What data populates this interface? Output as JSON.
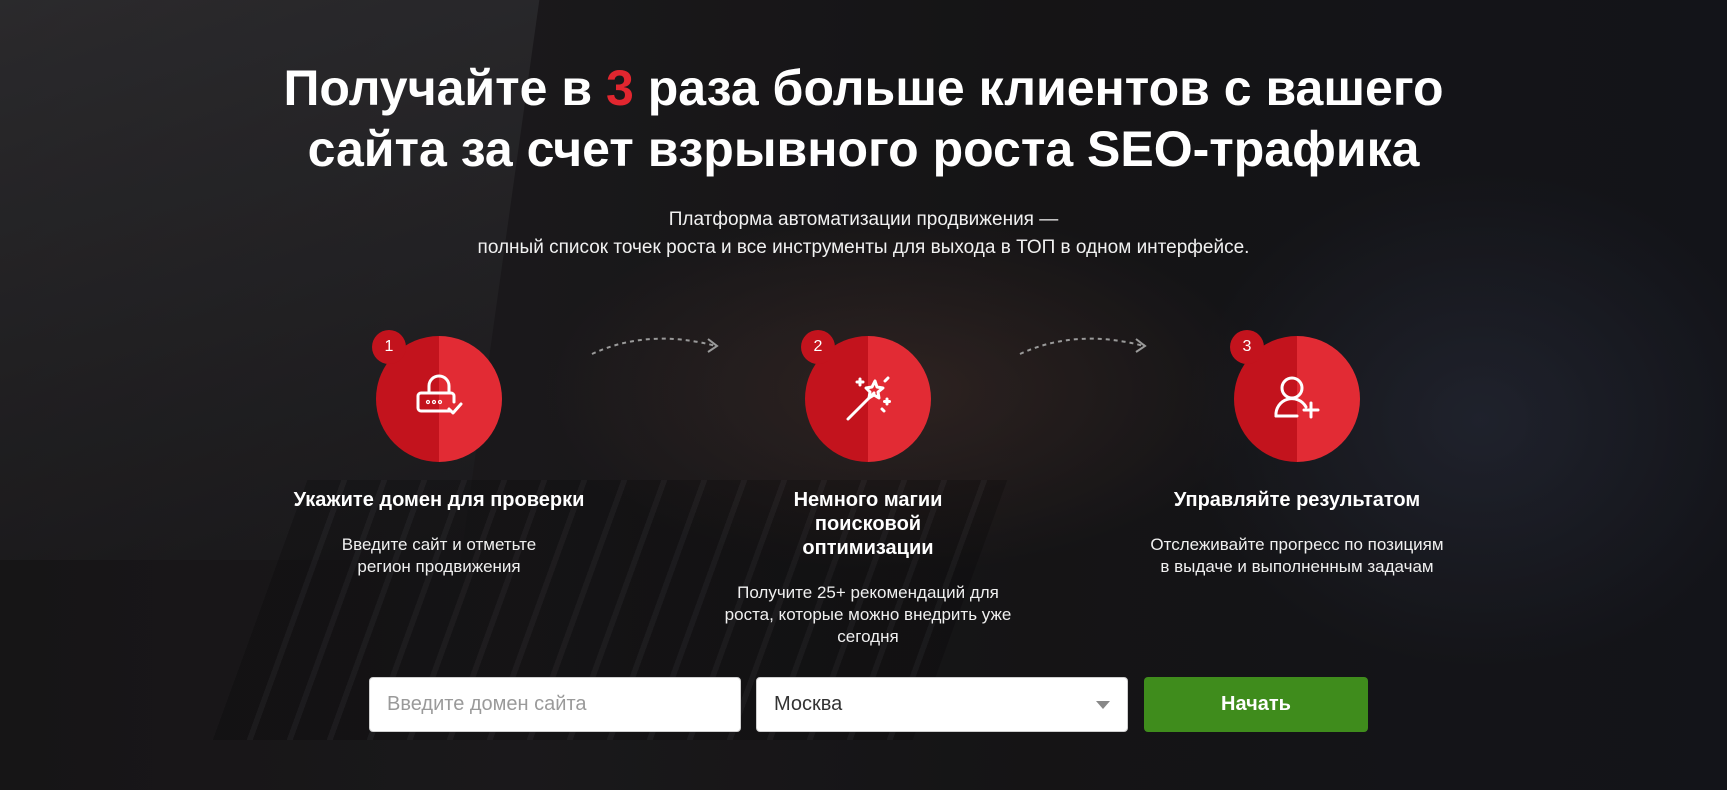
{
  "hero": {
    "title_part1": "Получайте в ",
    "title_accent": "3",
    "title_part2": " раза больше клиентов с вашего",
    "title_line2": "сайта за счет взрывного роста SEO-трафика",
    "subtitle_line1": "Платформа автоматизации продвижения —",
    "subtitle_line2": "полный список точек роста и все инструменты для выхода в ТОП в одном интерфейсе.",
    "accent_color": "#e2262f"
  },
  "steps": [
    {
      "number": "1",
      "icon": "lock-check-icon",
      "title": "Укажите домен для проверки",
      "text": "Введите сайт и отметьте регион продвижения"
    },
    {
      "number": "2",
      "icon": "magic-wand-icon",
      "title": "Немного магии поисковой оптимизации",
      "text": "Получите 25+ рекомендаций для роста, которые можно внедрить уже сегодня"
    },
    {
      "number": "3",
      "icon": "add-user-icon",
      "title": "Управляйте результатом",
      "text": "Отслеживайте прогресс по позициям в выдаче и выполненным задачам"
    }
  ],
  "form": {
    "domain_placeholder": "Введите домен сайта",
    "domain_value": "",
    "region_value": "Москва",
    "submit_label": "Начать",
    "button_color": "#3f8c1c"
  }
}
